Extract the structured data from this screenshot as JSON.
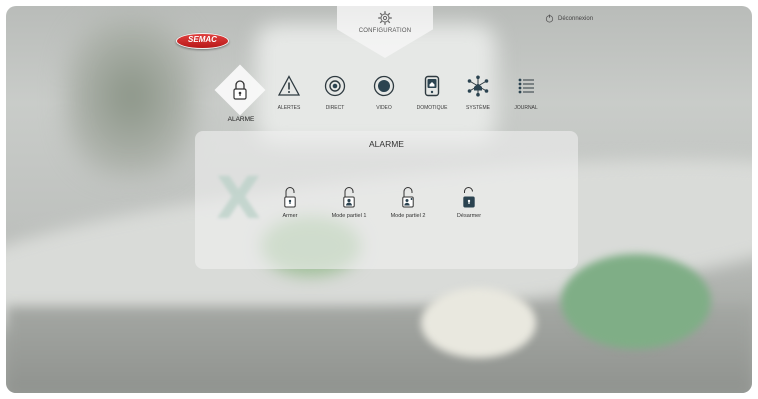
{
  "header": {
    "config_label": "CONFIGURATION",
    "logout_label": "Déconnexion",
    "logo_text": "SEMAC"
  },
  "nav": {
    "active": "ALARME",
    "items": [
      {
        "id": "alertes",
        "label": "ALERTES",
        "icon": "warning-icon"
      },
      {
        "id": "direct",
        "label": "DIRECT",
        "icon": "camera-icon"
      },
      {
        "id": "video",
        "label": "VIDEO",
        "icon": "record-icon"
      },
      {
        "id": "domotique",
        "label": "DOMOTIQUE",
        "icon": "home-automation-icon"
      },
      {
        "id": "systeme",
        "label": "SYSTÈME",
        "icon": "network-icon"
      },
      {
        "id": "journal",
        "label": "JOURNAL",
        "icon": "list-icon"
      }
    ]
  },
  "panel": {
    "title": "ALARME",
    "actions": [
      {
        "label": "Armer",
        "icon": "lock-open-icon"
      },
      {
        "label": "Mode partiel 1",
        "icon": "person-lock-icon"
      },
      {
        "label": "Mode partiel 2",
        "icon": "person-plus-lock-icon"
      },
      {
        "label": "Désarmer",
        "icon": "unlock-icon"
      }
    ]
  },
  "colors": {
    "accent_dark": "#2b4350",
    "logo_red": "#c8232a"
  }
}
